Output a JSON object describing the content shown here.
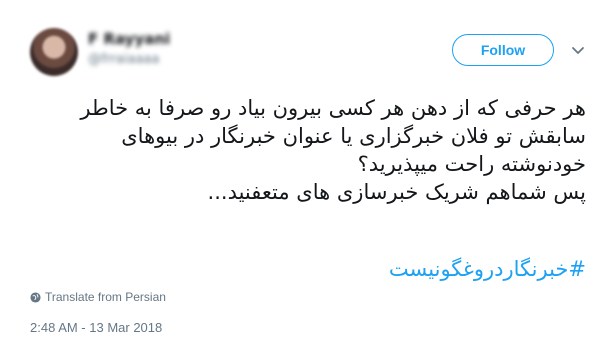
{
  "user": {
    "display_name": "F Rayyani",
    "handle": "@frraiaaaa"
  },
  "follow_button": {
    "label": "Follow"
  },
  "tweet": {
    "lines": [
      "هر حرفی که از دهن هر کسی بیرون بیاد رو صرفا به خاطر",
      "سابقش تو فلان خبرگزاری یا عنوان خبرنگار در بیوهای",
      "خودنوشته راحت میپذیرید؟",
      "پس شماهم شریک خبرسازی های متعفنید..."
    ],
    "hashtag": "#خبرنگاردروغگونیست"
  },
  "translate_label": "Translate from Persian",
  "timestamp": "2:48 AM - 13 Mar 2018",
  "icons": {
    "more": "chevron-down-icon",
    "translate": "globe-icon"
  },
  "colors": {
    "accent": "#1da1f2",
    "text": "#14171a",
    "muted": "#657786"
  }
}
